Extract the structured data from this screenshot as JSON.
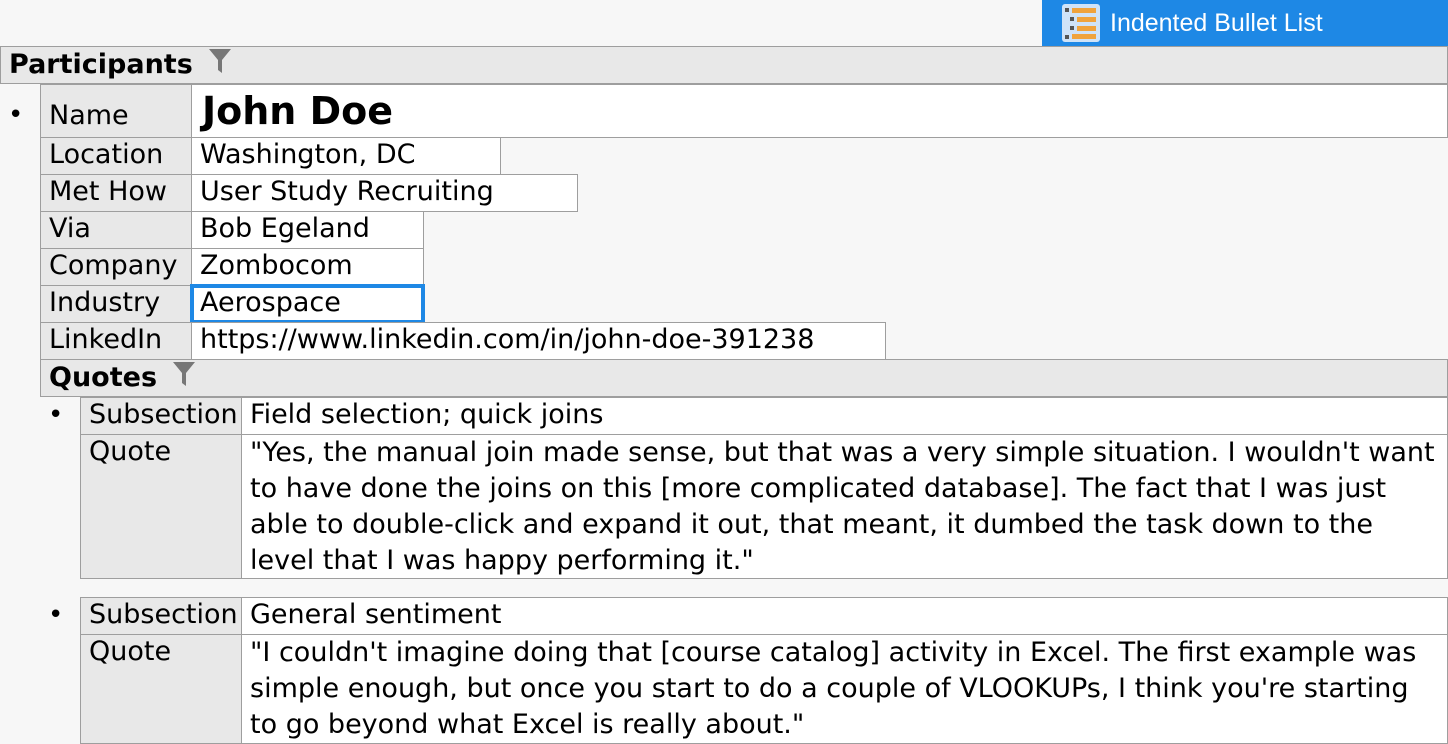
{
  "view_badge": {
    "label": "Indented Bullet List",
    "icon": "indented-list-icon",
    "color": "#1e88e5"
  },
  "participants": {
    "header": "Participants",
    "filter_icon": "filter-icon",
    "record": {
      "bullet": "•",
      "fields": [
        {
          "label": "Name",
          "value": "John Doe"
        },
        {
          "label": "Location",
          "value": "Washington, DC"
        },
        {
          "label": "Met How",
          "value": "User Study Recruiting"
        },
        {
          "label": "Via",
          "value": "Bob Egeland"
        },
        {
          "label": "Company",
          "value": "Zombocom"
        },
        {
          "label": "Industry",
          "value": "Aerospace"
        },
        {
          "label": "LinkedIn",
          "value": "https://www.linkedin.com/in/john-doe-391238"
        }
      ]
    }
  },
  "quotes": {
    "header": "Quotes",
    "filter_icon": "filter-icon",
    "items": [
      {
        "bullet": "•",
        "subsection_label": "Subsection",
        "subsection": "Field selection; quick joins",
        "quote_label": "Quote",
        "quote": "\"Yes, the manual join made sense, but that was a very simple situation. I wouldn't want to have done the joins on this [more complicated database]. The fact that I was just able to double-click and expand it out, that meant, it dumbed the task down to the level that I was happy performing it.\""
      },
      {
        "bullet": "•",
        "subsection_label": "Subsection",
        "subsection": "General sentiment",
        "quote_label": "Quote",
        "quote": "\"I couldn't imagine doing that [course catalog] activity in Excel. The first example was simple enough, but once you start to do a couple of VLOOKUPs, I think you're starting to go beyond what Excel is really about.\""
      }
    ]
  },
  "selected_cell": "Industry"
}
